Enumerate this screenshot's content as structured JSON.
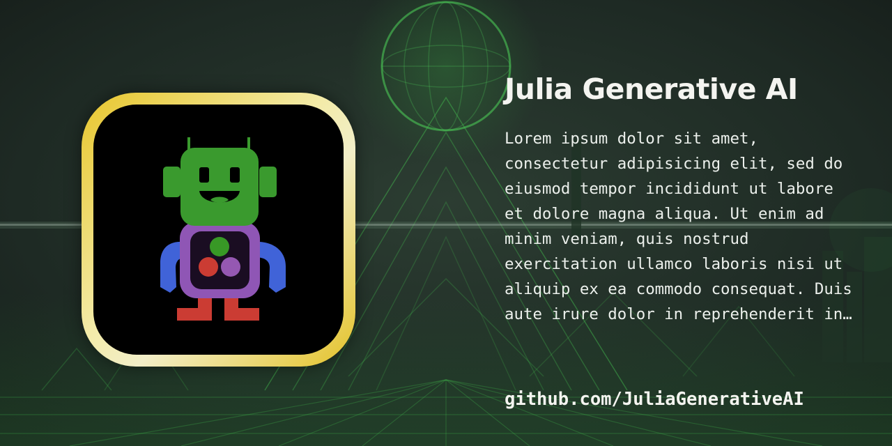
{
  "title": "Julia Generative AI",
  "description": "Lorem ipsum dolor sit amet, consectetur adipisicing elit, sed do eiusmod tempor incididunt ut labore et dolore magna aliqua. Ut enim ad minim veniam, quis nostrud exercitation ullamco laboris nisi ut aliquip ex ea commodo consequat. Duis aute irure dolor in reprehenderit in…",
  "link": "github.com/JuliaGenerativeAI",
  "logo": {
    "icon": "robot-icon",
    "colors": {
      "head": "#3a9a2e",
      "body": "#8f56b5",
      "arms": "#4063d8",
      "legs": "#cb3c33",
      "dot_top": "#389826",
      "dot_left": "#cb3c33",
      "dot_right": "#9558b2",
      "frame": "#e8c62c"
    }
  },
  "background": {
    "base": "#1b2520",
    "glow": "#3fbf4a"
  }
}
